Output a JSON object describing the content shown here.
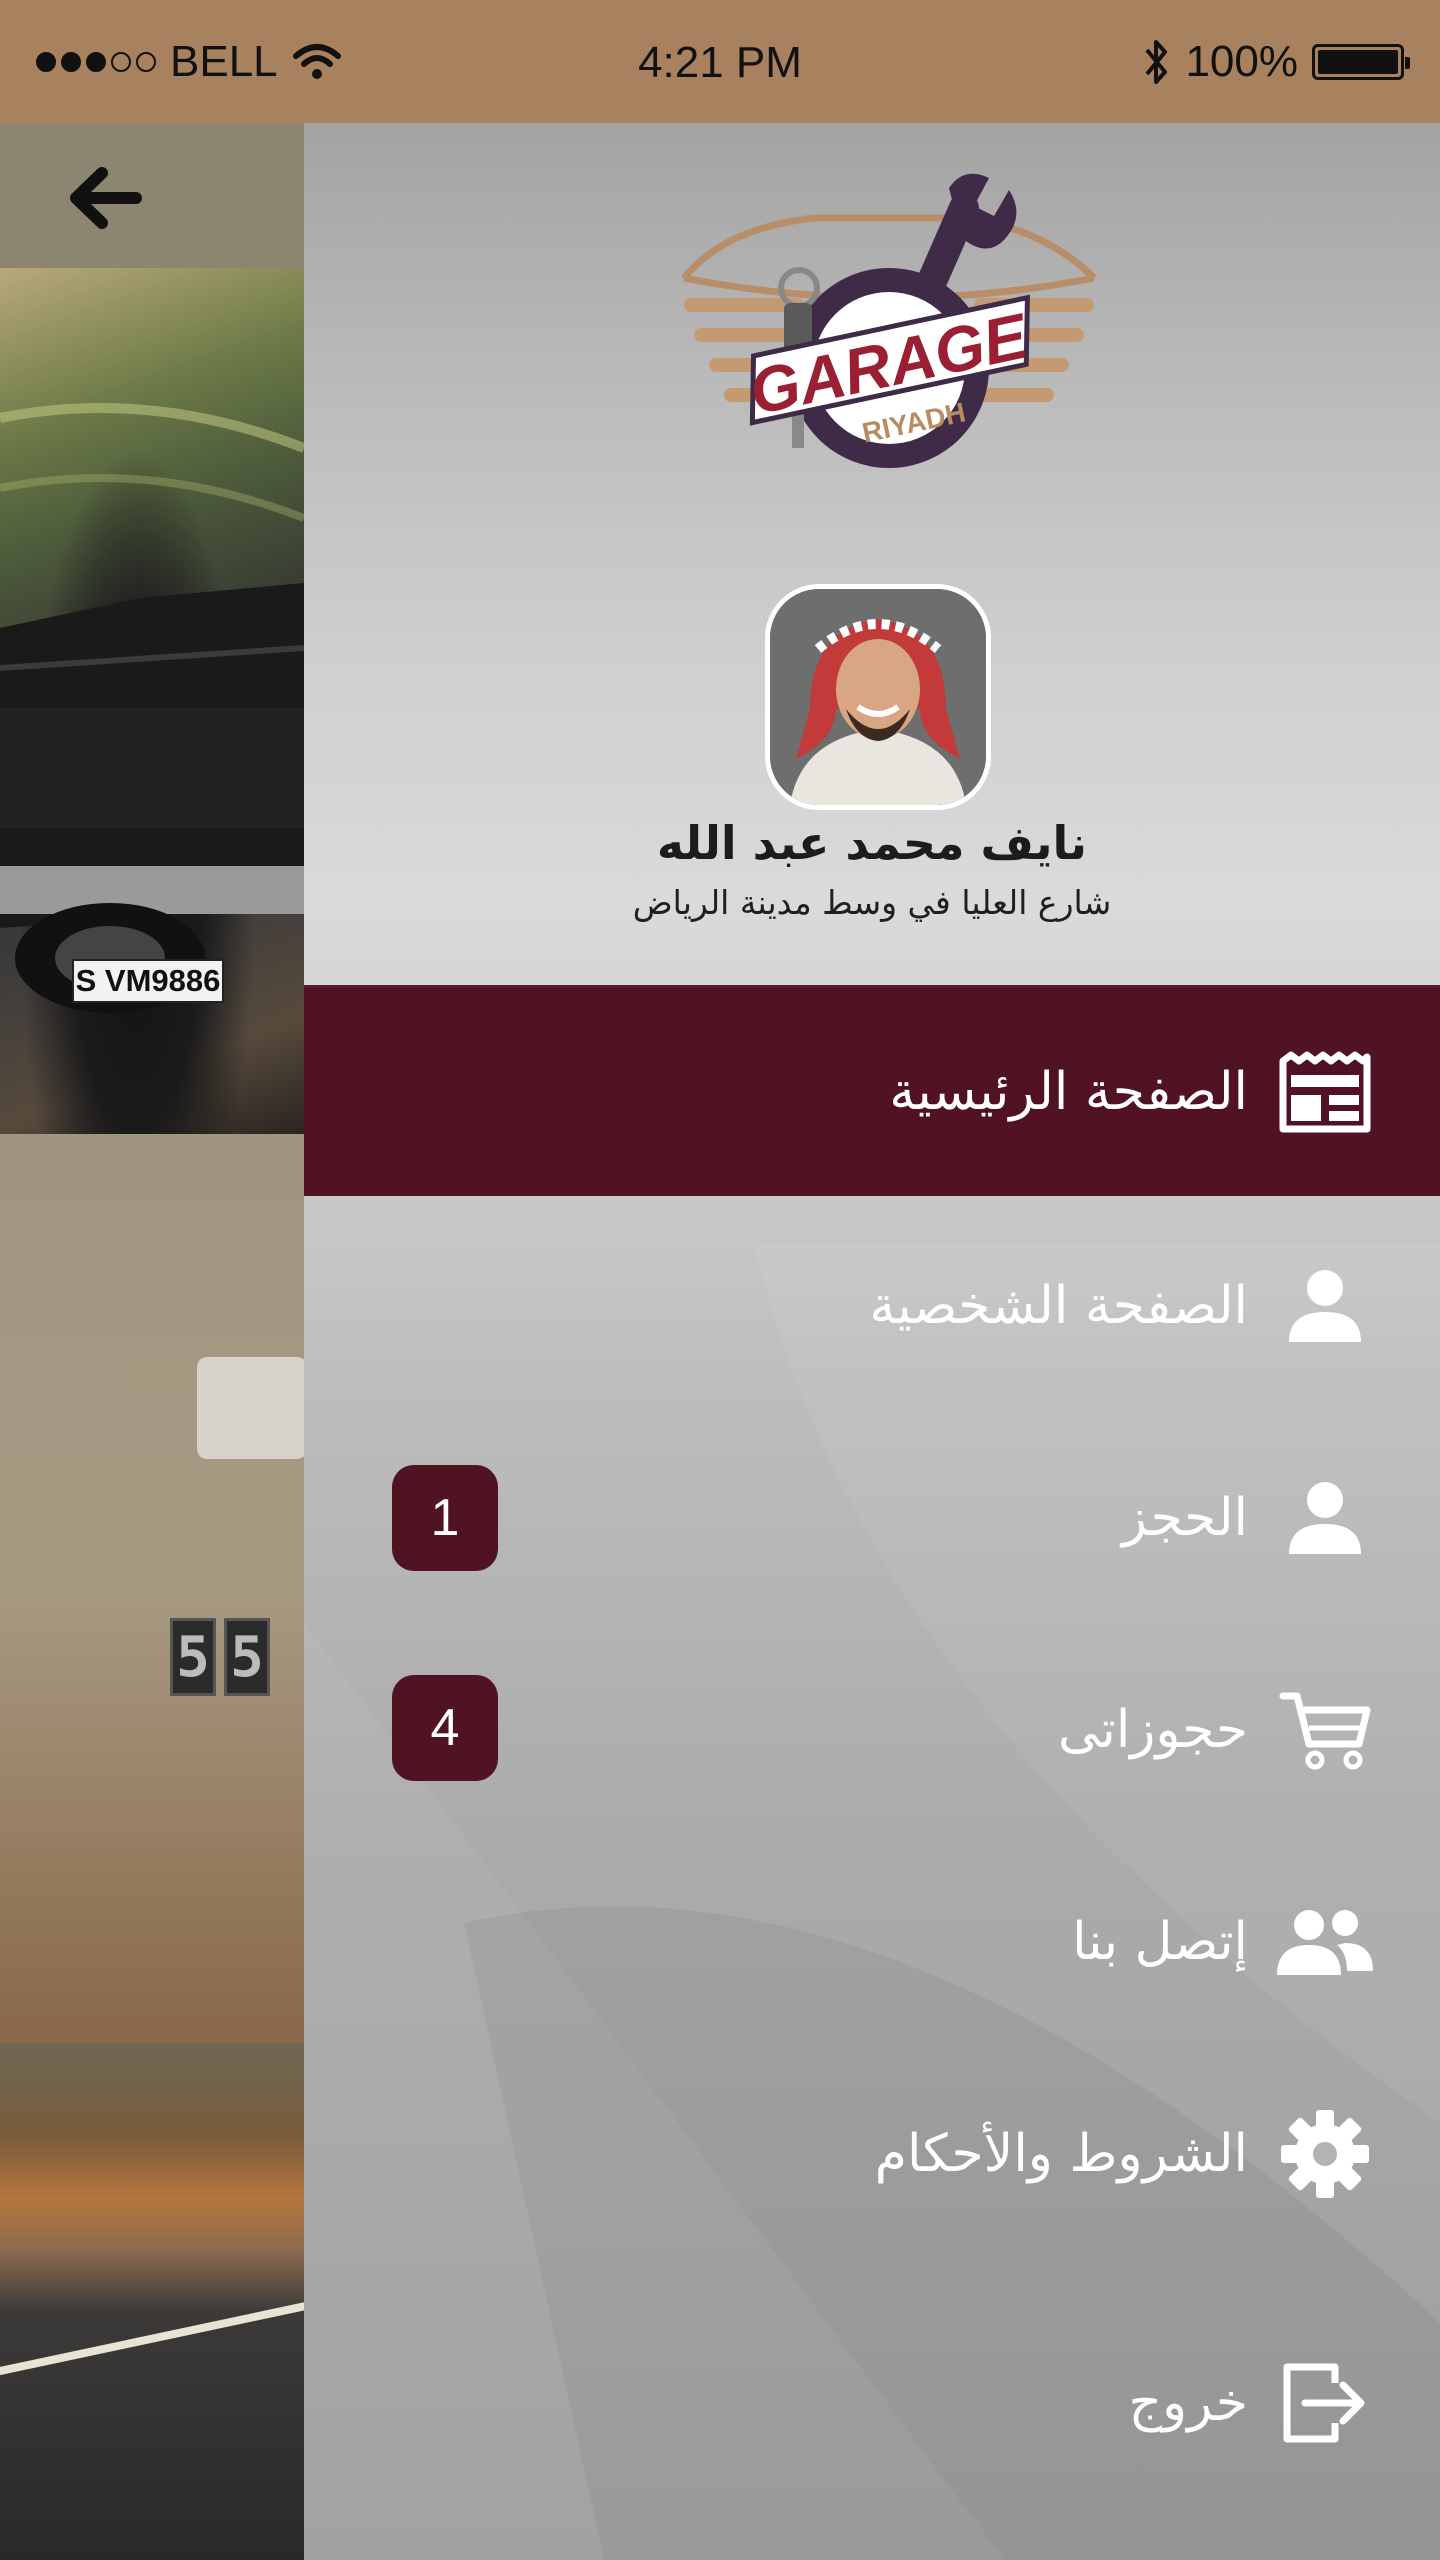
{
  "status_bar": {
    "carrier": "BELL",
    "time": "4:21 PM",
    "battery_percent": "100%",
    "battery_level": 1.0,
    "signal_bars_filled": 3,
    "signal_bars_total": 5
  },
  "background_screen": {
    "license_plate": "S VM9886",
    "digits": [
      "5",
      "5"
    ]
  },
  "profile": {
    "name": "نايف محمد عبد الله",
    "address": "شارع العليا في وسط مدينة الرياض"
  },
  "logo": {
    "text": "GARAGE",
    "subtext": "RIYADH"
  },
  "menu": {
    "items": [
      {
        "label": "الصفحة الرئيسية",
        "icon": "newspaper-icon",
        "active": true
      },
      {
        "label": "الصفحة الشخصية",
        "icon": "user-icon"
      },
      {
        "label": "الحجز",
        "icon": "user-icon",
        "badge": "1"
      },
      {
        "label": "حجوزاتى",
        "icon": "cart-icon",
        "badge": "4"
      },
      {
        "label": "إتصل بنا",
        "icon": "users-icon"
      },
      {
        "label": "الشروط والأحكام",
        "icon": "gear-icon"
      },
      {
        "label": "خروج",
        "icon": "logout-icon"
      }
    ]
  },
  "colors": {
    "accent": "#511223",
    "status_bar": "#a8825f",
    "drawer_text": "#ffffff"
  }
}
